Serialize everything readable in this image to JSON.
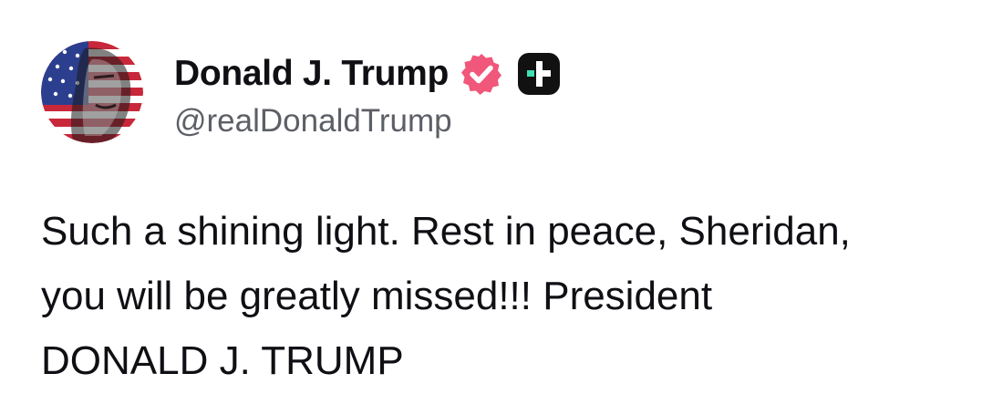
{
  "author": {
    "display_name": "Donald J. Trump",
    "handle": "@realDonaldTrump",
    "avatar_icon": "flag-portrait-avatar",
    "verified_icon": "verified-badge-icon",
    "platform_icon": "truth-social-logo-icon"
  },
  "post": {
    "lines": [
      "Such a shining light. Rest in peace, Sheridan,",
      "you will be greatly missed!!! President",
      "DONALD J. TRUMP"
    ]
  },
  "colors": {
    "verified_badge": "#f0577a",
    "platform_badge": "#111111",
    "platform_accent": "#3ee0b3",
    "handle_text": "#5d5f66",
    "text": "#0f0f14"
  }
}
